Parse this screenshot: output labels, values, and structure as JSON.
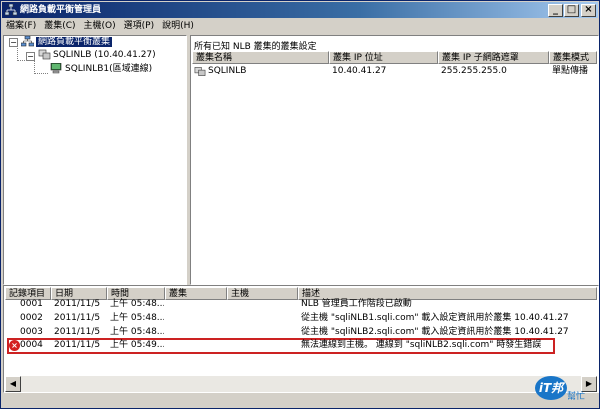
{
  "window": {
    "title": "網路負載平衡管理員"
  },
  "menu": [
    "檔案(F)",
    "叢集(C)",
    "主機(O)",
    "選項(P)",
    "說明(H)"
  ],
  "tree": {
    "root_label": "網路負載平衡叢集",
    "cluster_label": "SQLINLB (10.40.41.27)",
    "host_label": "SQLINLB1(區域連線)"
  },
  "clusters_panel": {
    "title": "所有已知 NLB 叢集的叢集設定",
    "columns": [
      "叢集名稱",
      "叢集 IP 位址",
      "叢集 IP 子網路遮罩",
      "叢集模式"
    ],
    "rows": [
      [
        "SQLINLB",
        "10.40.41.27",
        "255.255.255.0",
        "單點傳播"
      ]
    ]
  },
  "log": {
    "columns": [
      "記錄項目",
      "日期",
      "時間",
      "叢集",
      "主機",
      "描述"
    ],
    "rows": [
      {
        "entry": "0001",
        "date": "2011/11/5",
        "time": "上午 05:48...",
        "cluster": "",
        "host": "",
        "desc": "NLB 管理員工作階段已啟動",
        "error": false
      },
      {
        "entry": "0002",
        "date": "2011/11/5",
        "time": "上午 05:48...",
        "cluster": "",
        "host": "",
        "desc": "從主機 \"sqliNLB1.sqli.com\" 載入設定資訊用於叢集 10.40.41.27",
        "error": false
      },
      {
        "entry": "0003",
        "date": "2011/11/5",
        "time": "上午 05:48...",
        "cluster": "",
        "host": "",
        "desc": "從主機 \"sqliNLB2.sqli.com\" 載入設定資訊用於叢集 10.40.41.27",
        "error": false
      },
      {
        "entry": "0004",
        "date": "2011/11/5",
        "time": "上午 05:49...",
        "cluster": "",
        "host": "",
        "desc": "無法連線到主機。 連線到 \"sqliNLB2.sqli.com\" 時發生錯誤",
        "error": true
      }
    ]
  },
  "watermark": {
    "bubble": "iT邦",
    "text": "幫忙"
  },
  "colors": {
    "title_start": "#0a246a",
    "title_end": "#a6caf0",
    "error": "#d42020",
    "highlight": "#cc2222",
    "logo": "#1a76c8"
  },
  "icons": {
    "app": "network-icon",
    "root": "network-cluster-icon",
    "cluster": "cluster-icon",
    "host": "computer-icon",
    "error": "error-icon"
  }
}
